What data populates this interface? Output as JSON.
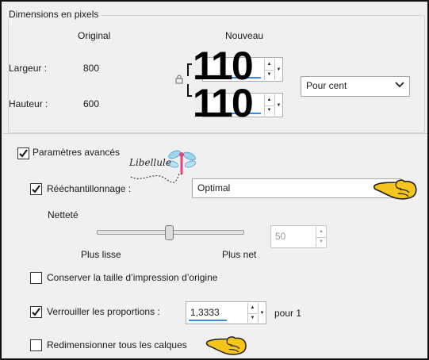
{
  "pixel_dimensions": {
    "group_title": "Dimensions en pixels",
    "col_original": "Original",
    "col_new": "Nouveau",
    "width_label": "Largeur :",
    "height_label": "Hauteur :",
    "width_original": "800",
    "height_original": "600",
    "width_new": "110",
    "height_new": "110",
    "unit_selected": "Pour cent",
    "lock_icon": "lock-icon"
  },
  "advanced": {
    "label": "Paramètres avancés",
    "checked": true,
    "watermark": "Libellule",
    "resample_label": "Rééchantillonnage :",
    "resample_checked": true,
    "resample_method": "Optimal",
    "sharpness_label": "Netteté",
    "sharpness_value": "50",
    "slider_min_label": "Plus lisse",
    "slider_max_label": "Plus net",
    "keep_print_label": "Conserver la taille d’impression d’origine",
    "keep_print_checked": false,
    "lock_ratio_label": "Verrouiller les proportions :",
    "lock_ratio_checked": true,
    "ratio_value": "1,3333",
    "ratio_suffix": "pour 1",
    "resize_layers_label": "Redimensionner tous les calques",
    "resize_layers_checked": false
  },
  "colors": {
    "accent_blue": "#3c8be3",
    "pointer_yellow": "#f5c51b"
  }
}
